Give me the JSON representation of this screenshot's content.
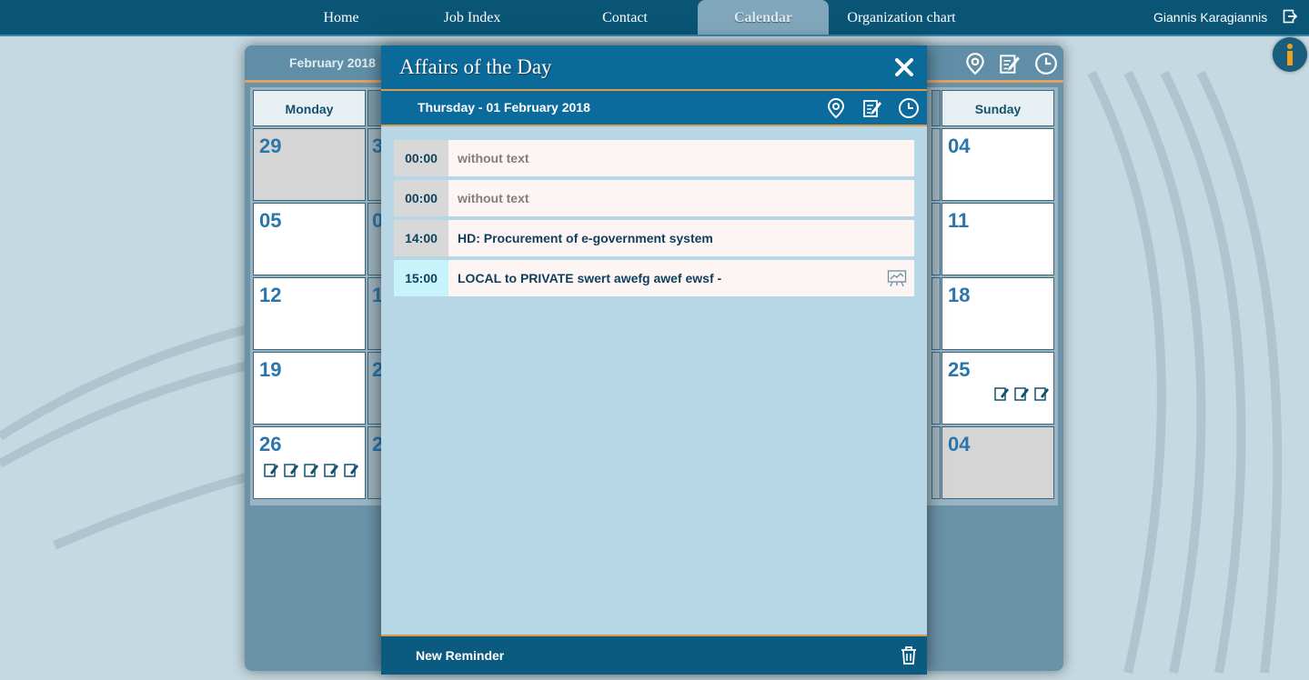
{
  "nav": {
    "items": [
      {
        "label": "Home"
      },
      {
        "label": "Job Index"
      },
      {
        "label": "Contact"
      },
      {
        "label": "Calendar",
        "active": true
      },
      {
        "label": "Organization chart"
      }
    ],
    "user_name": "Giannis Karagiannis"
  },
  "calendar": {
    "month_label": "February 2018",
    "weekday_headers": {
      "monday": "Monday",
      "sunday": "Sunday"
    },
    "monday_days": [
      "29",
      "05",
      "12",
      "19",
      "26"
    ],
    "tuesday_partial_digits": [
      "3",
      "0",
      "1",
      "2",
      "2"
    ],
    "sunday_days": [
      "04",
      "11",
      "18",
      "25",
      "04"
    ],
    "reminder_icon_counts": {
      "monday_26": 5,
      "sunday_25": 3
    }
  },
  "modal": {
    "title": "Affairs of the Day",
    "date_label": "Thursday - 01 February 2018",
    "events": [
      {
        "time": "00:00",
        "text": "without text",
        "muted": true
      },
      {
        "time": "00:00",
        "text": "without text",
        "muted": true
      },
      {
        "time": "14:00",
        "text": "HD: Procurement of e-government system",
        "muted": false
      },
      {
        "time": "15:00",
        "text": "LOCAL to PRIVATE swert awefg awef ewsf -",
        "muted": false,
        "highlight": true,
        "icon": "presentation-chart-icon"
      }
    ],
    "footer": {
      "new_reminder_label": "New Reminder"
    }
  },
  "colors": {
    "nav_bg": "#0a5576",
    "modal_header": "#0a6a9a",
    "accent_orange": "#e39a44",
    "day_number": "#2a76ab",
    "event_text": "#0f3f5e"
  }
}
